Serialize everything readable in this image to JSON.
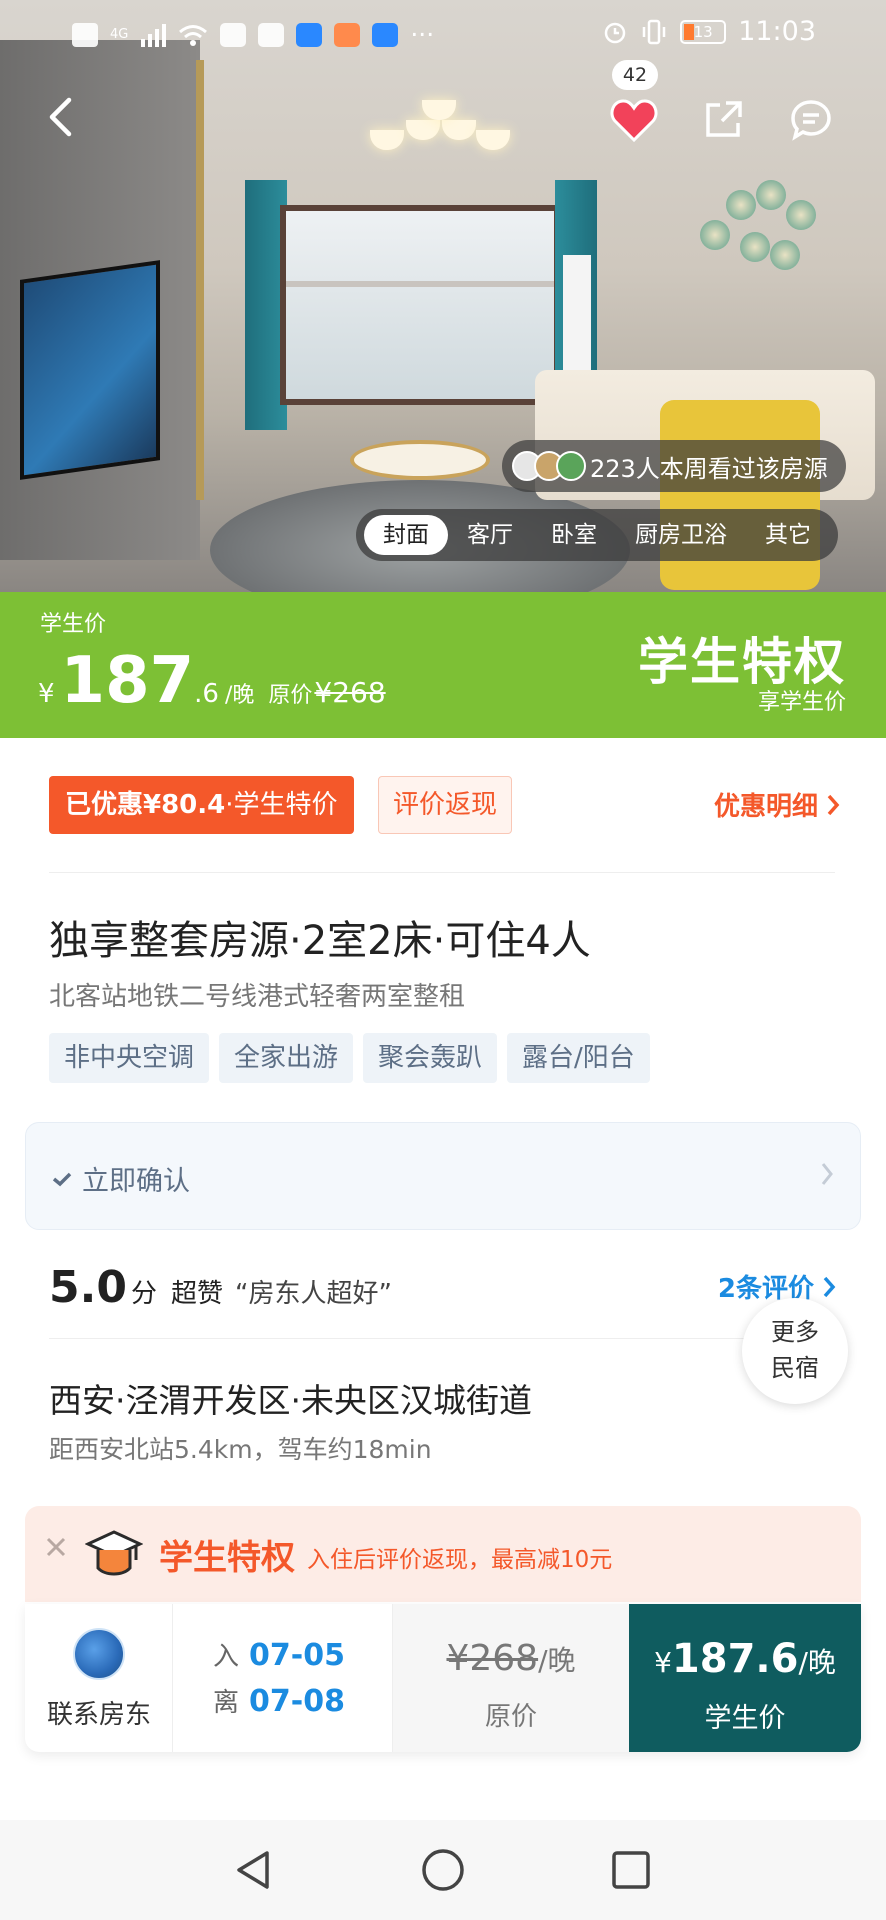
{
  "status_bar": {
    "time": "11:03",
    "battery": "13",
    "network": "4G"
  },
  "hero": {
    "favorite_count": "42",
    "viewers_text": "223人本周看过该房源",
    "photo_tabs": [
      {
        "label": "封面",
        "active": true
      },
      {
        "label": "客厅",
        "active": false
      },
      {
        "label": "卧室",
        "active": false
      },
      {
        "label": "厨房卫浴",
        "active": false
      },
      {
        "label": "其它",
        "active": false
      }
    ]
  },
  "price_banner": {
    "label": "学生价",
    "currency": "¥",
    "price_int": "187",
    "price_dec": ".6",
    "unit": "/晚",
    "orig_label": "原价",
    "orig_value": "¥268",
    "privilege_title": "学生特权",
    "privilege_sub": "享学生价",
    "bg_color": "#7dc035"
  },
  "discount": {
    "tag_bold": "已优惠¥80.4",
    "tag_light": "·学生特价",
    "cashback": "评价返现",
    "detail_link": "优惠明细"
  },
  "listing": {
    "title": "独享整套房源·2室2床·可住4人",
    "subtitle": "北客站地铁二号线港式轻奢两室整租",
    "tags": [
      "非中央空调",
      "全家出游",
      "聚会轰趴",
      "露台/阳台"
    ]
  },
  "confirm": {
    "label": "立即确认"
  },
  "rating": {
    "score": "5.0",
    "unit": "分",
    "word": "超赞",
    "quote": "“房东人超好”",
    "reviews_link": "2条评价",
    "more_line1": "更多",
    "more_line2": "民宿"
  },
  "location": {
    "address": "西安·泾渭开发区·未央区汉城街道",
    "distance": "距西安北站5.4km，驾车约18min"
  },
  "privilege_bar": {
    "title": "学生特权",
    "desc": "入住后评价返现，最高减10元"
  },
  "booking": {
    "contact_label": "联系房东",
    "checkin_label": "入",
    "checkin_date": "07-05",
    "checkout_label": "离",
    "checkout_date": "07-08",
    "orig_price": "¥268",
    "orig_unit": "/晚",
    "orig_label": "原价",
    "price_currency": "¥",
    "price": "187.6",
    "price_unit": "/晚",
    "price_label": "学生价",
    "button_color": "#0f5c5f"
  },
  "navbar": {
    "icons": [
      "back-triangle-icon",
      "home-circle-icon",
      "recent-square-icon"
    ]
  }
}
